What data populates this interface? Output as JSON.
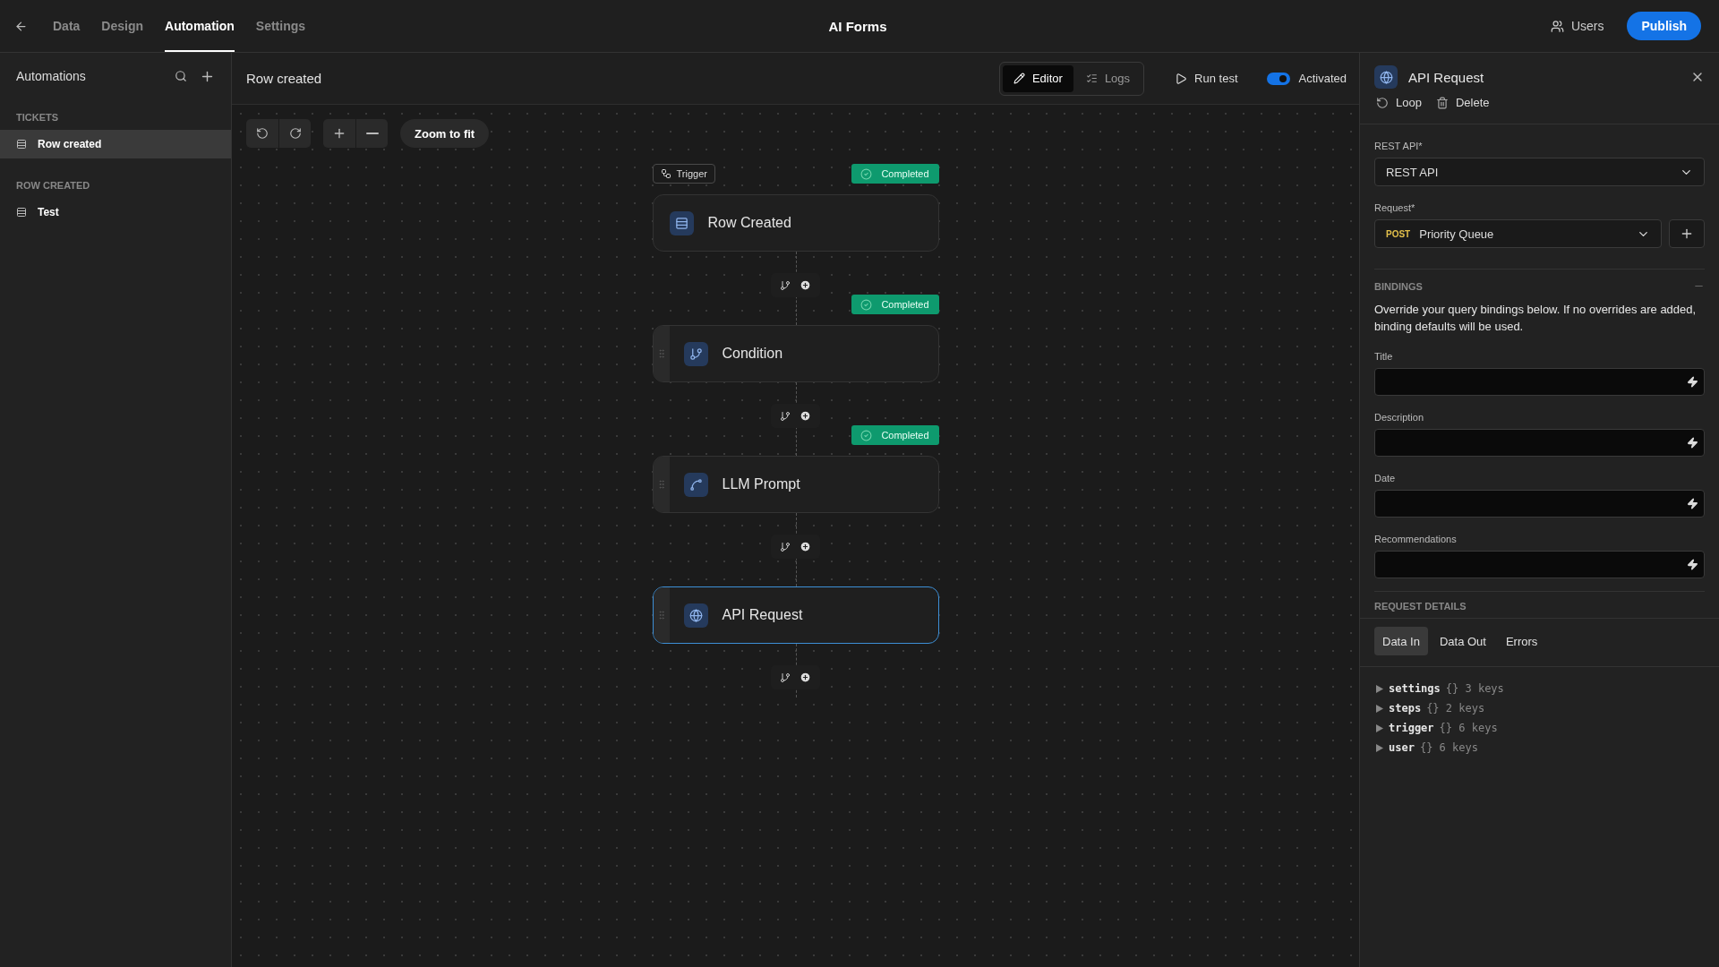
{
  "topbar": {
    "nav": [
      {
        "label": "Data",
        "selected": false
      },
      {
        "label": "Design",
        "selected": false
      },
      {
        "label": "Automation",
        "selected": true
      },
      {
        "label": "Settings",
        "selected": false
      }
    ],
    "title": "AI Forms",
    "users": "Users",
    "publish": "Publish"
  },
  "sidebar": {
    "title": "Automations",
    "groups": [
      {
        "heading": "TICKETS",
        "items": [
          {
            "label": "Row created",
            "selected": true
          }
        ]
      },
      {
        "heading": "ROW CREATED",
        "items": [
          {
            "label": "Test",
            "selected": false
          }
        ]
      }
    ]
  },
  "canvas": {
    "title": "Row created",
    "modes": [
      {
        "label": "Editor",
        "selected": true
      },
      {
        "label": "Logs",
        "selected": false
      }
    ],
    "run_test": "Run test",
    "activated": {
      "label": "Activated",
      "on": true
    },
    "zoom_to_fit": "Zoom to fit",
    "trigger_tag": "Trigger",
    "steps": [
      {
        "name": "Row Created",
        "kind": "trigger",
        "status": "Completed",
        "selected": false
      },
      {
        "name": "Condition",
        "kind": "condition",
        "status": "Completed",
        "selected": false
      },
      {
        "name": "LLM Prompt",
        "kind": "llm",
        "status": "Completed",
        "selected": false
      },
      {
        "name": "API Request",
        "kind": "api",
        "selected": true
      }
    ]
  },
  "panel": {
    "title": "API Request",
    "actions": [
      {
        "label": "Loop",
        "kind": "loop"
      },
      {
        "label": "Delete",
        "kind": "delete"
      }
    ],
    "rest_api": {
      "label": "REST API*",
      "value": "REST API"
    },
    "request": {
      "label": "Request*",
      "method": "POST",
      "value": "Priority Queue"
    },
    "bindings": {
      "heading": "BINDINGS",
      "description": "Override your query bindings below. If no overrides are added, binding defaults will be used.",
      "inputs": [
        {
          "label": "Title"
        },
        {
          "label": "Description"
        },
        {
          "label": "Date"
        },
        {
          "label": "Recommendations"
        }
      ]
    },
    "next_section": "REQUEST DETAILS",
    "tabs": [
      {
        "label": "Data In",
        "selected": true
      },
      {
        "label": "Data Out",
        "selected": false
      },
      {
        "label": "Errors",
        "selected": false
      }
    ],
    "tree": [
      {
        "key": "settings",
        "summary": "{} 3 keys"
      },
      {
        "key": "steps",
        "summary": "{} 2 keys"
      },
      {
        "key": "trigger",
        "summary": "{} 6 keys"
      },
      {
        "key": "user",
        "summary": "{} 6 keys"
      }
    ]
  }
}
